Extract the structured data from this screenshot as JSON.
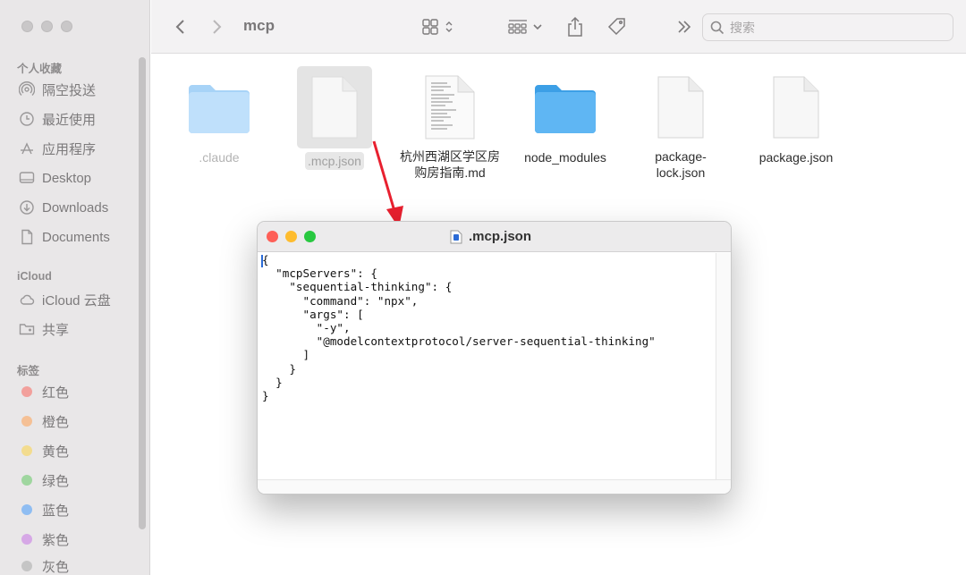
{
  "window": {
    "title": "mcp"
  },
  "sidebar": {
    "favorites_header": "个人收藏",
    "favorites": [
      {
        "label": "隔空投送",
        "icon": "airdrop-icon"
      },
      {
        "label": "最近使用",
        "icon": "clock-icon"
      },
      {
        "label": "应用程序",
        "icon": "applications-icon"
      },
      {
        "label": "Desktop",
        "icon": "desktop-icon"
      },
      {
        "label": "Downloads",
        "icon": "downloads-icon"
      },
      {
        "label": "Documents",
        "icon": "document-icon"
      }
    ],
    "icloud_header": "iCloud",
    "icloud": [
      {
        "label": "iCloud 云盘",
        "icon": "cloud-icon"
      },
      {
        "label": "共享",
        "icon": "shared-folder-icon"
      }
    ],
    "tags_header": "标签",
    "tags": [
      {
        "label": "红色",
        "color": "#f2a09c"
      },
      {
        "label": "橙色",
        "color": "#f5c095"
      },
      {
        "label": "黄色",
        "color": "#f3dc8f"
      },
      {
        "label": "绿色",
        "color": "#9fd69f"
      },
      {
        "label": "蓝色",
        "color": "#8fbdf2"
      },
      {
        "label": "紫色",
        "color": "#d6a8e6"
      },
      {
        "label": "灰色",
        "color": "#c5c5c5"
      }
    ]
  },
  "toolbar": {
    "search_placeholder": "搜索"
  },
  "files": [
    {
      "name": ".claude",
      "type": "folder-light"
    },
    {
      "name": ".mcp.json",
      "type": "doc",
      "selected": true
    },
    {
      "name": "杭州西湖区学区房购房指南.md",
      "line1": "杭州西湖区学区房",
      "line2": "购房指南.md",
      "type": "text"
    },
    {
      "name": "node_modules",
      "type": "folder"
    },
    {
      "name": "package-lock.json",
      "line1": "package-",
      "line2": "lock.json",
      "type": "doc"
    },
    {
      "name": "package.json",
      "type": "doc"
    }
  ],
  "editor": {
    "title": ".mcp.json",
    "content": "{\n  \"mcpServers\": {\n    \"sequential-thinking\": {\n      \"command\": \"npx\",\n      \"args\": [\n        \"-y\",\n        \"@modelcontextprotocol/server-sequential-thinking\"\n      ]\n    }\n  }\n}"
  },
  "colors": {
    "accent": "#2b6bd6",
    "arrow": "#e8202f",
    "close": "#fe5f57",
    "minimize": "#febc2e",
    "zoom": "#28c840"
  }
}
